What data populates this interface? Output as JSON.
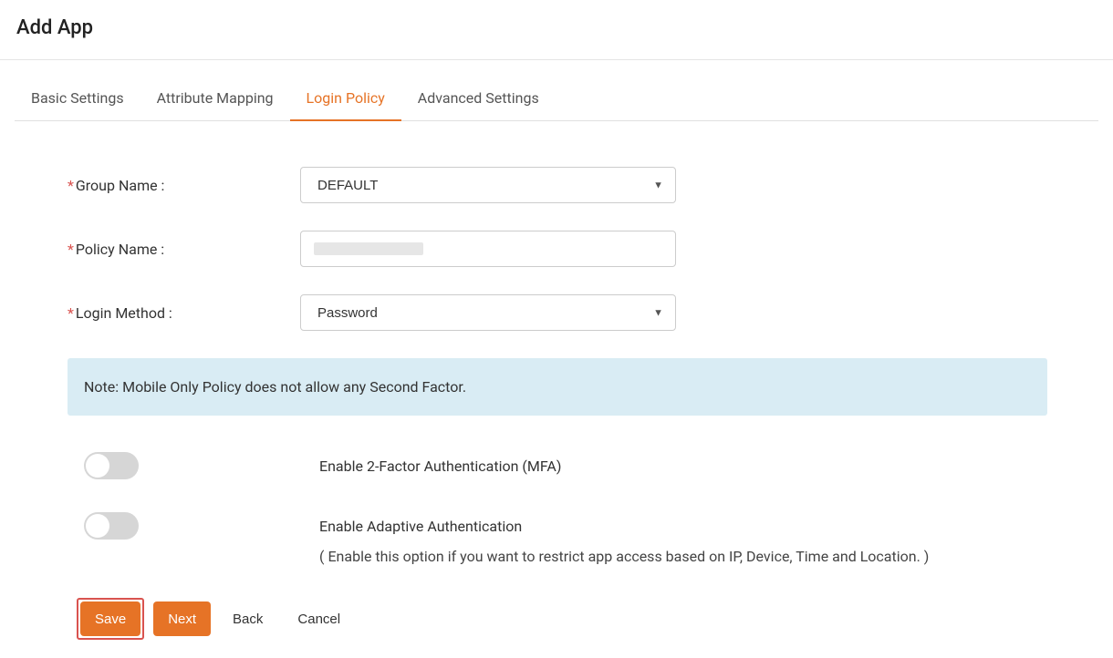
{
  "header": {
    "title": "Add App"
  },
  "tabs": {
    "basic": "Basic Settings",
    "attribute": "Attribute Mapping",
    "login": "Login Policy",
    "advanced": "Advanced Settings",
    "active": "login"
  },
  "form": {
    "group_name": {
      "label": "Group Name :",
      "value": "DEFAULT"
    },
    "policy_name": {
      "label": "Policy Name :",
      "value": ""
    },
    "login_method": {
      "label": "Login Method :",
      "value": "Password"
    }
  },
  "note": "Note: Mobile Only Policy does not allow any Second Factor.",
  "toggles": {
    "mfa": {
      "label": "Enable 2-Factor Authentication (MFA)",
      "on": false
    },
    "adaptive": {
      "label": "Enable Adaptive Authentication",
      "sub": "( Enable this option if you want to restrict app access based on IP, Device, Time and Location. )",
      "on": false
    }
  },
  "buttons": {
    "save": "Save",
    "next": "Next",
    "back": "Back",
    "cancel": "Cancel"
  }
}
